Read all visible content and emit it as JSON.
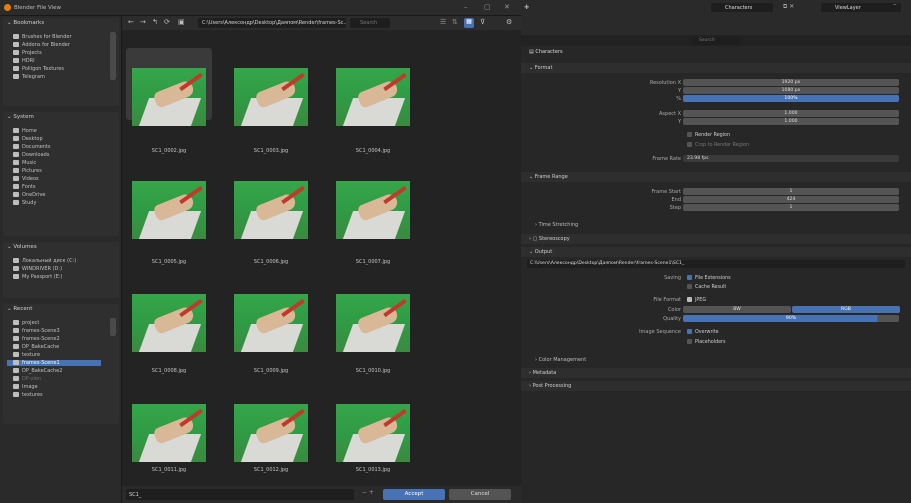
{
  "window": {
    "title": "Blender File View"
  },
  "bookmarks": {
    "header": "Bookmarks",
    "items": [
      "Brushes for Blender",
      "Addons for Blender",
      "Projects",
      "HDRI",
      "Poliigon Textures",
      "Telegram"
    ]
  },
  "system": {
    "header": "System",
    "items": [
      "Home",
      "Desktop",
      "Documents",
      "Downloads",
      "Music",
      "Pictures",
      "Videos",
      "Fonts",
      "OneDrive",
      "Study"
    ]
  },
  "volumes": {
    "header": "Volumes",
    "items": [
      "Локальный диск (C:)",
      "WINDRIVER (D:)",
      "My Passport (E:)"
    ]
  },
  "recent": {
    "header": "Recent",
    "items": [
      "project",
      "frames-Scene3",
      "frames-Scene2",
      "DP_BakeCache",
      "texture",
      "frames-Scene1",
      "DP_BakeCache2",
      "DP-vien",
      "Image",
      "textures"
    ],
    "selected_index": 5
  },
  "toolbar": {
    "path": "C:\\Users\\Алексондр\\Desktop\\Даяпом\\Render\\frames-Sc...",
    "search_placeholder": "Search"
  },
  "files": [
    "SC1_0002.jpg",
    "SC1_0003.jpg",
    "SC1_0004.jpg",
    "SC1_0005.jpg",
    "SC1_0006.jpg",
    "SC1_0007.jpg",
    "SC1_0008.jpg",
    "SC1_0009.jpg",
    "SC1_0010.jpg",
    "SC1_0011.jpg",
    "SC1_0012.jpg",
    "SC1_0013.jpg"
  ],
  "bottom": {
    "filename": "SC1_",
    "accept": "Accept",
    "cancel": "Cancel"
  },
  "right_top": {
    "scene": "Characters",
    "view_layer": "ViewLayer",
    "search_placeholder": "Search"
  },
  "properties": {
    "header": "Characters",
    "format": {
      "title": "Format",
      "res_x_label": "Resolution X",
      "res_x": "1920 px",
      "res_y_label": "Y",
      "res_y": "1080 px",
      "pct_label": "%",
      "pct": "100%",
      "aspect_x_label": "Aspect X",
      "aspect_x": "1.000",
      "aspect_y_label": "Y",
      "aspect_y": "1.000",
      "render_region": "Render Region",
      "crop": "Crop to Render Region",
      "frame_rate_label": "Frame Rate",
      "frame_rate": "23.98 fps"
    },
    "frame_range": {
      "title": "Frame Range",
      "start_label": "Frame Start",
      "start": "1",
      "end_label": "End",
      "end": "424",
      "step_label": "Step",
      "step": "1",
      "time_stretching": "Time Stretching"
    },
    "stereoscopy": "Stereoscopy",
    "output": {
      "title": "Output",
      "path": "C:\\Users\\Алексондр\\Desktop\\Даяпом\\Render\\frames-Scene1\\SC1_",
      "saving_label": "Saving",
      "file_extensions": "File Extensions",
      "cache_result": "Cache Result",
      "file_format_label": "File Format",
      "file_format": "JPEG",
      "color_label": "Color",
      "color_bw": "BW",
      "color_rgb": "RGB",
      "quality_label": "Quality",
      "quality": "90%",
      "image_sequence_label": "Image Sequence",
      "overwrite": "Overwrite",
      "placeholders": "Placeholders",
      "color_management": "Color Management"
    },
    "metadata": "Metadata",
    "post_processing": "Post Processing"
  },
  "colors": {
    "accent": "#4772b3",
    "bg": "#262626",
    "panel": "#2f2f2f"
  }
}
